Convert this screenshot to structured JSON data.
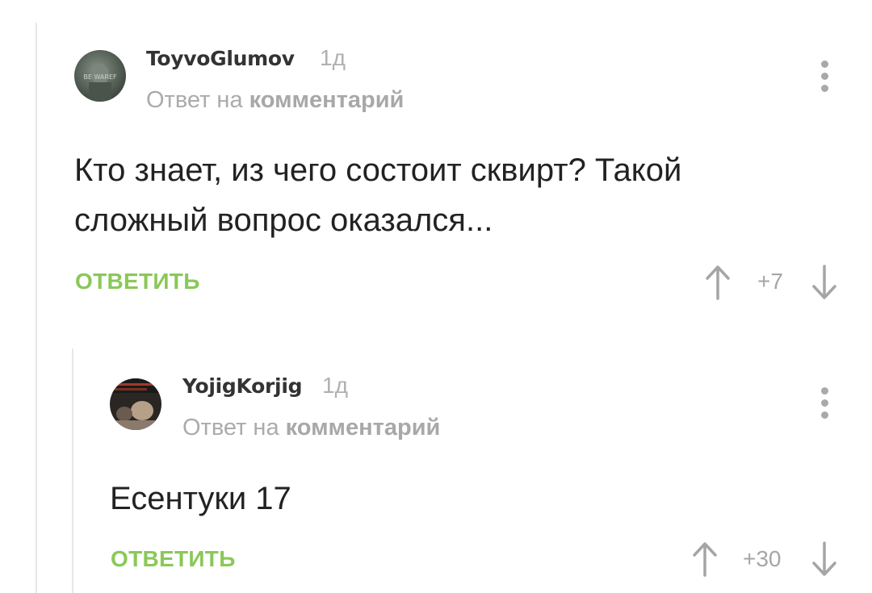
{
  "comments": [
    {
      "author": "ToyvoGlumov",
      "time": "1д",
      "reply_prefix": "Ответ на",
      "reply_link": "комментарий",
      "text": "Кто знает, из чего состоит сквирт? Такой сложный вопрос оказался...",
      "reply_label": "ОТВЕТИТЬ",
      "score": "+7",
      "avatar_caption": "BE WAREF"
    },
    {
      "author": "YojigKorjig",
      "time": "1д",
      "reply_prefix": "Ответ на",
      "reply_link": "комментарий",
      "text": "Есентуки 17",
      "reply_label": "ОТВЕТИТЬ",
      "score": "+30"
    }
  ],
  "colors": {
    "accent_green": "#8ac858",
    "muted_gray": "#a9a9a9",
    "thread_line": "#e7e7e7"
  },
  "icons": [
    "more-vertical-icon",
    "arrow-up-icon",
    "arrow-down-icon"
  ]
}
